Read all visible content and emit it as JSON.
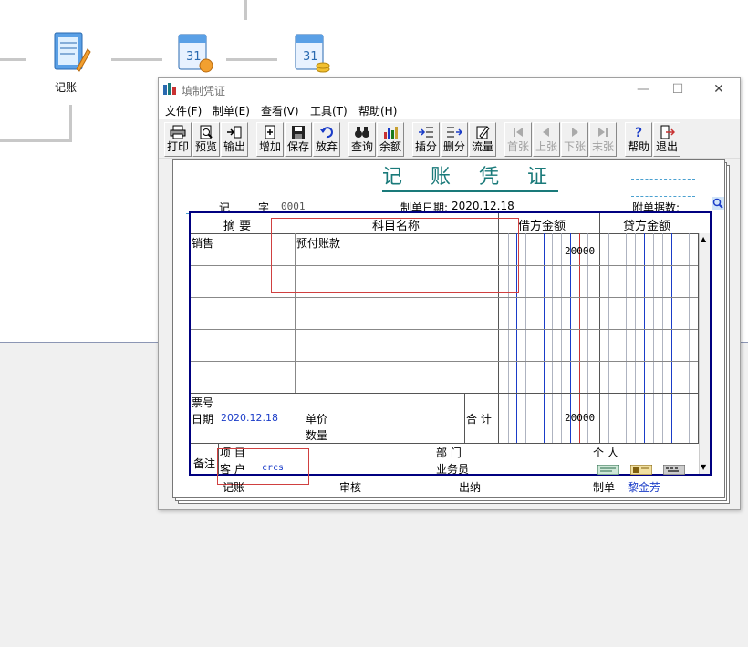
{
  "flow": {
    "node_label": "记账"
  },
  "window": {
    "title": "填制凭证",
    "controls": {
      "minimize": "—",
      "maximize": "☐",
      "close": "✕"
    }
  },
  "menu": [
    "文件(F)",
    "制单(E)",
    "查看(V)",
    "工具(T)",
    "帮助(H)"
  ],
  "toolbar": [
    {
      "label": "打印",
      "icon": "printer-icon",
      "enabled": true
    },
    {
      "label": "预览",
      "icon": "preview-icon",
      "enabled": true
    },
    {
      "label": "输出",
      "icon": "export-icon",
      "enabled": true
    },
    {
      "label": "增加",
      "icon": "add-doc-icon",
      "enabled": true
    },
    {
      "label": "保存",
      "icon": "save-icon",
      "enabled": true
    },
    {
      "label": "放弃",
      "icon": "undo-icon",
      "enabled": true
    },
    {
      "label": "查询",
      "icon": "binoculars-icon",
      "enabled": true
    },
    {
      "label": "余额",
      "icon": "bar-chart-icon",
      "enabled": true
    },
    {
      "label": "插分",
      "icon": "insert-row-icon",
      "enabled": true
    },
    {
      "label": "删分",
      "icon": "delete-row-icon",
      "enabled": true
    },
    {
      "label": "流量",
      "icon": "cashflow-icon",
      "enabled": true
    },
    {
      "label": "首张",
      "icon": "first-icon",
      "enabled": false
    },
    {
      "label": "上张",
      "icon": "prev-icon",
      "enabled": false
    },
    {
      "label": "下张",
      "icon": "next-icon",
      "enabled": false
    },
    {
      "label": "末张",
      "icon": "last-icon",
      "enabled": false
    },
    {
      "label": "帮助",
      "icon": "help-icon",
      "enabled": true
    },
    {
      "label": "退出",
      "icon": "exit-icon",
      "enabled": true
    }
  ],
  "voucher": {
    "title": "记 账 凭 证",
    "type_char": "记",
    "word_char": "字",
    "number": "0001",
    "date_label": "制单日期:",
    "date": "2020.12.18",
    "attachments_label": "附单据数:",
    "columns": {
      "summary": "摘 要",
      "account": "科目名称",
      "debit": "借方金额",
      "credit": "贷方金额"
    },
    "rows": [
      {
        "summary": "销售",
        "account": "预付账款",
        "debit": "20000",
        "credit": ""
      }
    ],
    "bill_no_label": "票号",
    "bill_date_label": "日期",
    "bill_date": "2020.12.18",
    "unit_price_label": "单价",
    "quantity_label": "数量",
    "total_label": "合 计",
    "total_debit": "20000",
    "remark_label": "备注",
    "project_label": "项 目",
    "customer_label": "客 户",
    "customer_value": "crcs",
    "department_label": "部 门",
    "salesperson_label": "业务员",
    "personal_label": "个 人"
  },
  "footer": {
    "posting_label": "记账",
    "audit_label": "审核",
    "cashier_label": "出纳",
    "maker_label": "制单",
    "maker_name": "黎金芳"
  },
  "colors": {
    "accent": "#1a7a7a",
    "table_border": "#000080",
    "debit_lines": "#1a3cc8",
    "credit_lines": "#c83232"
  }
}
